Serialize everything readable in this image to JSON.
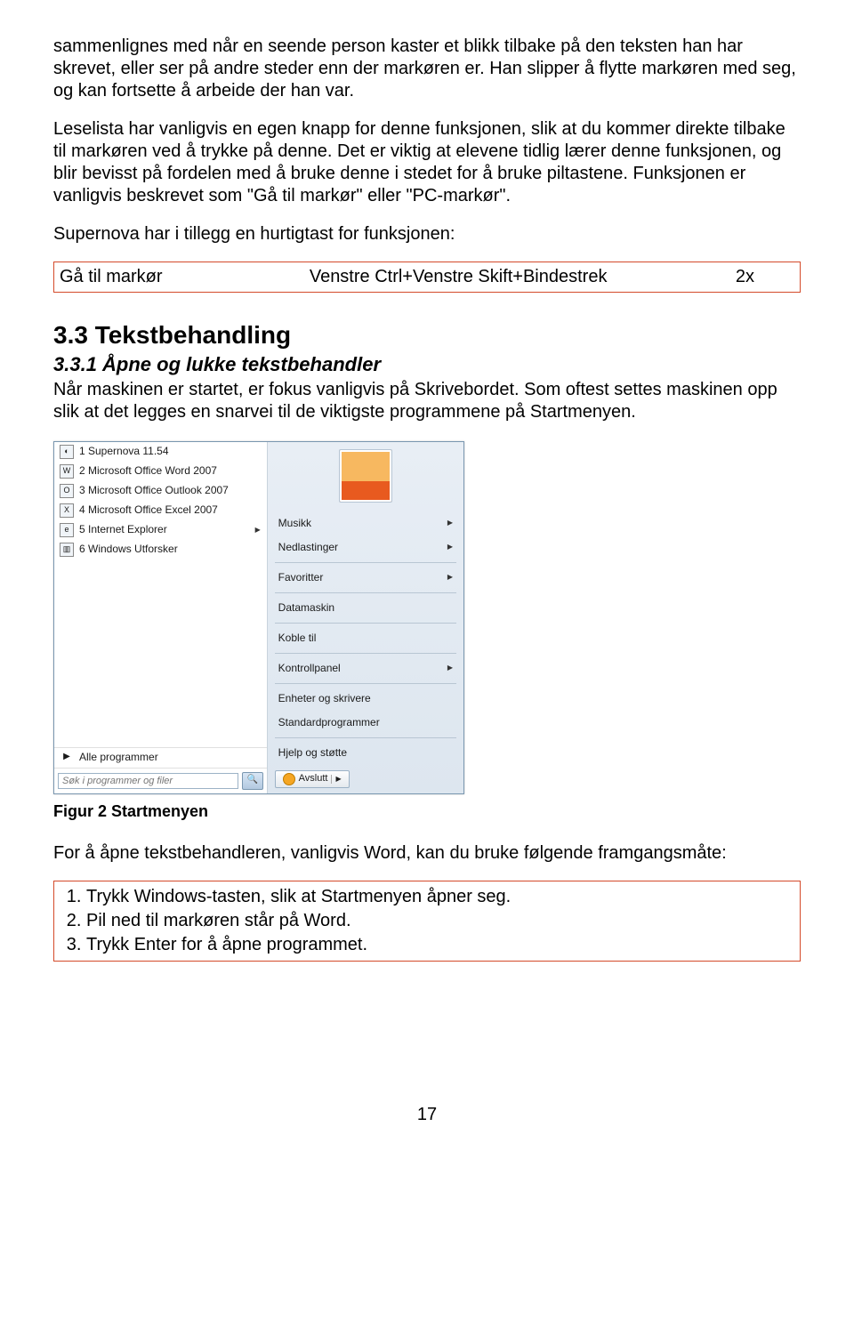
{
  "para1": "sammenlignes med når en seende person kaster et blikk tilbake på den teksten han har skrevet, eller ser på andre steder enn der markøren er. Han slipper å flytte markøren med seg, og kan fortsette å arbeide der han var.",
  "para2": "Leselista har vanligvis en egen knapp for denne funksjonen, slik at du kommer direkte tilbake til markøren ved å trykke på denne. Det er viktig at elevene tidlig lærer denne funksjonen, og blir bevisst på fordelen med å bruke denne i stedet for å bruke piltastene. Funksjonen er vanligvis beskrevet som \"Gå til markør\" eller \"PC-markør\".",
  "para3": "Supernova har i tillegg en hurtigtast for funksjonen:",
  "shortcut": {
    "name": "Gå til markør",
    "keys": "Venstre Ctrl+Venstre Skift+Bindestrek",
    "count": "2x"
  },
  "h2": "3.3 Tekstbehandling",
  "h3": "3.3.1 Åpne og lukke tekstbehandler",
  "para4": "Når maskinen er startet, er fokus vanligvis på Skrivebordet. Som oftest settes maskinen opp slik at det legges en snarvei til de viktigste programmene på Startmenyen.",
  "startmenu": {
    "left_items": [
      {
        "icon": "supernova-icon",
        "label": "1 Supernova 11.54"
      },
      {
        "icon": "word-icon",
        "label": "2 Microsoft Office Word 2007"
      },
      {
        "icon": "outlook-icon",
        "label": "3 Microsoft Office Outlook 2007"
      },
      {
        "icon": "excel-icon",
        "label": "4 Microsoft Office Excel 2007"
      },
      {
        "icon": "ie-icon",
        "label": "5 Internet Explorer",
        "has_arrow": true
      },
      {
        "icon": "explorer-icon",
        "label": "6 Windows Utforsker"
      }
    ],
    "all_programs": "Alle programmer",
    "search_placeholder": "Søk i programmer og filer",
    "right_items": [
      {
        "label": "Musikk",
        "arrow": true
      },
      {
        "label": "Nedlastinger",
        "arrow": true
      },
      {
        "label": "Favoritter",
        "arrow": true
      },
      {
        "label": "Datamaskin"
      },
      {
        "label": "Koble til"
      },
      {
        "label": "Kontrollpanel",
        "arrow": true
      },
      {
        "label": "Enheter og skrivere"
      },
      {
        "label": "Standardprogrammer"
      },
      {
        "label": "Hjelp og støtte"
      }
    ],
    "shutdown": "Avslutt"
  },
  "fig_caption": "Figur 2 Startmenyen",
  "para5": "For å åpne tekstbehandleren, vanligvis Word, kan du bruke følgende framgangsmåte:",
  "steps": [
    "Trykk Windows-tasten, slik at Startmenyen åpner seg.",
    "Pil ned til markøren står på Word.",
    "Trykk Enter for å åpne programmet."
  ],
  "page_number": "17"
}
